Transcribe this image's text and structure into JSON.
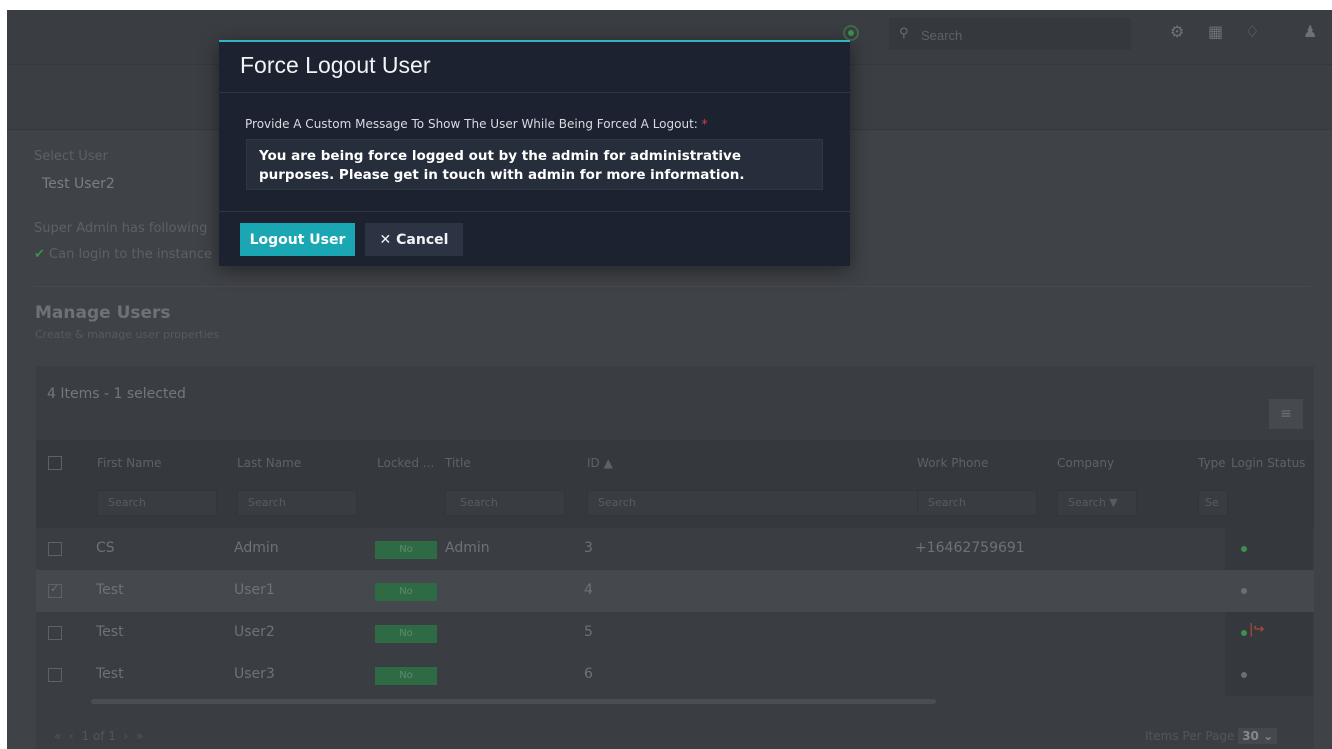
{
  "topbar": {
    "search_placeholder": "Search",
    "icons": [
      "status-online-icon",
      "search-icon",
      "gear-icon",
      "hierarchy-icon",
      "bell-icon",
      "user-icon"
    ]
  },
  "background": {
    "select_user_label": "Select User",
    "select_user_value": "Test User2",
    "super_admin_text": "Super Admin has following",
    "permission_text": "Can login to the instance",
    "manage_title": "Manage Users",
    "manage_subtitle": "Create & manage user properties"
  },
  "grid": {
    "count_label": "4 Items - 1 selected",
    "columns": {
      "first_name": "First Name",
      "last_name": "Last Name",
      "locked": "Locked ...",
      "title": "Title",
      "id": "ID",
      "work_phone": "Work Phone",
      "company": "Company",
      "type": "Type",
      "login_status": "Login Status"
    },
    "search_placeholder": "Search",
    "type_search_placeholder": "Se",
    "rows": [
      {
        "first": "CS",
        "last": "Admin",
        "locked": "No",
        "title": "Admin",
        "id": "3",
        "phone": "+16462759691",
        "checked": false
      },
      {
        "first": "Test",
        "last": "User1",
        "locked": "No",
        "title": "",
        "id": "4",
        "phone": "",
        "checked": true
      },
      {
        "first": "Test",
        "last": "User2",
        "locked": "No",
        "title": "",
        "id": "5",
        "phone": "",
        "checked": false
      },
      {
        "first": "Test",
        "last": "User3",
        "locked": "No",
        "title": "",
        "id": "6",
        "phone": "",
        "checked": false
      }
    ],
    "pager_text": "1 of 1",
    "items_per_page_label": "Items Per Page",
    "items_per_page_value": "30"
  },
  "modal": {
    "title": "Force Logout User",
    "message_label": "Provide A Custom Message To Show The User While Being Forced A Logout:",
    "required_mark": "*",
    "message_value": "You are being force logged out by the admin for administrative purposes. Please get in touch with admin for more information.",
    "logout_button": "Logout User",
    "cancel_button": "Cancel"
  },
  "colors": {
    "accent": "#1aa6b3",
    "modal_bg": "#1c2230",
    "overlay_bg": "#3f4247",
    "status_green": "#3d8f4e",
    "logout_red": "#b84a3e"
  }
}
